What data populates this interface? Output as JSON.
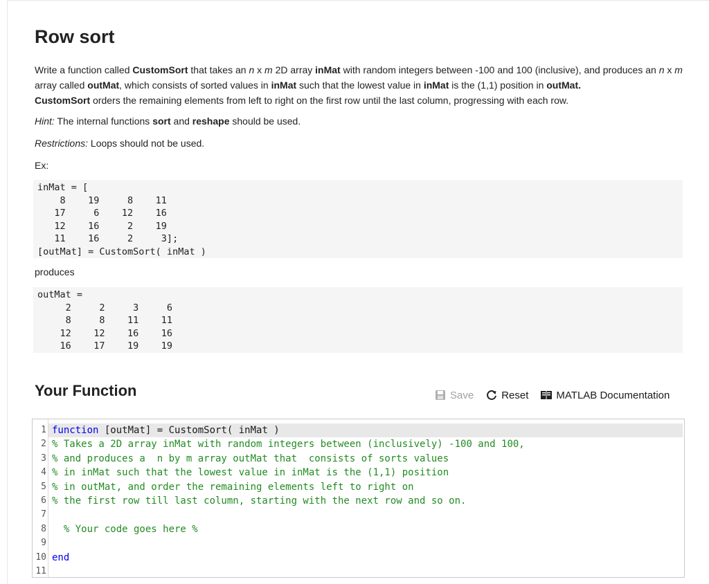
{
  "problem": {
    "title": "Row sort",
    "desc": {
      "p1": "Write a function called ",
      "b1": "CustomSort",
      "p2": " that takes an ",
      "i1": "n",
      "p3": " x ",
      "i2": "m",
      "p4": " 2D array ",
      "b2": "inMat",
      "p5": " with random integers between -100 and 100 (inclusive), and produces an ",
      "i3": "n",
      "p6": " x ",
      "i4": "m",
      "p7": " array called ",
      "b3": "outMat",
      "p8": ", which consists of sorted values in ",
      "b4": "inMat",
      "p9": " such that the lowest value in ",
      "b5": "inMat",
      "p10": " is the (1,1) position in ",
      "b6": "outMat.",
      "b7": "CustomSort",
      "p11": " orders the remaining elements from left to right on the first row until the last column, progressing with each row."
    },
    "hint": {
      "label": "Hint:",
      "t1": " The internal functions ",
      "b1": "sort",
      "t2": " and ",
      "b2": "reshape",
      "t3": " should be used."
    },
    "restrictions": {
      "label": "Restrictions:",
      "text": " Loops should not be used."
    },
    "ex_label": "Ex:",
    "example_code": "inMat = [\n    8    19     8    11\n   17     6    12    16\n   12    16     2    19\n   11    16     2     3];\n[outMat] = CustomSort( inMat )",
    "produces_label": "produces",
    "output_code": "outMat =\n     2     2     3     6\n     8     8    11    11\n    12    12    16    16\n    16    17    19    19"
  },
  "function_section": {
    "title": "Your Function",
    "save_label": "Save",
    "reset_label": "Reset",
    "docs_label": "MATLAB Documentation"
  },
  "editor": {
    "lines": [
      {
        "n": "1",
        "kw": "function",
        "text": " [outMat] = CustomSort( inMat )",
        "cm": ""
      },
      {
        "n": "2",
        "kw": "",
        "text": "",
        "cm": "% Takes a 2D array inMat with random integers between (inclusively) -100 and 100,"
      },
      {
        "n": "3",
        "kw": "",
        "text": "",
        "cm": "% and produces a  n by m array outMat that  consists of sorts values"
      },
      {
        "n": "4",
        "kw": "",
        "text": "",
        "cm": "% in inMat such that the lowest value in inMat is the (1,1) position"
      },
      {
        "n": "5",
        "kw": "",
        "text": "",
        "cm": "% in outMat, and order the remaining elements left to right on"
      },
      {
        "n": "6",
        "kw": "",
        "text": "",
        "cm": "% the first row till last column, starting with the next row and so on."
      },
      {
        "n": "7",
        "kw": "",
        "text": "",
        "cm": ""
      },
      {
        "n": "8",
        "kw": "",
        "text": "",
        "cm": "  % Your code goes here %"
      },
      {
        "n": "9",
        "kw": "",
        "text": "",
        "cm": ""
      },
      {
        "n": "10",
        "kw": "end",
        "text": "",
        "cm": ""
      },
      {
        "n": "11",
        "kw": "",
        "text": "",
        "cm": ""
      }
    ]
  },
  "colors": {
    "keyword": "#0000ee",
    "comment": "#228b22",
    "code_bg": "#f5f5f5"
  }
}
